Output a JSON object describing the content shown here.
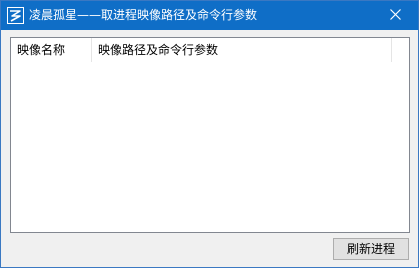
{
  "window": {
    "title": "凌晨孤星——取进程映像路径及命令行参数",
    "app_icon": "app-logo-icon",
    "close_icon": "close-icon",
    "accent_color": "#0f6ec7"
  },
  "listview": {
    "columns": [
      "映像名称",
      "映像路径及命令行参数"
    ],
    "rows": []
  },
  "buttons": {
    "refresh_label": "刷新进程"
  }
}
